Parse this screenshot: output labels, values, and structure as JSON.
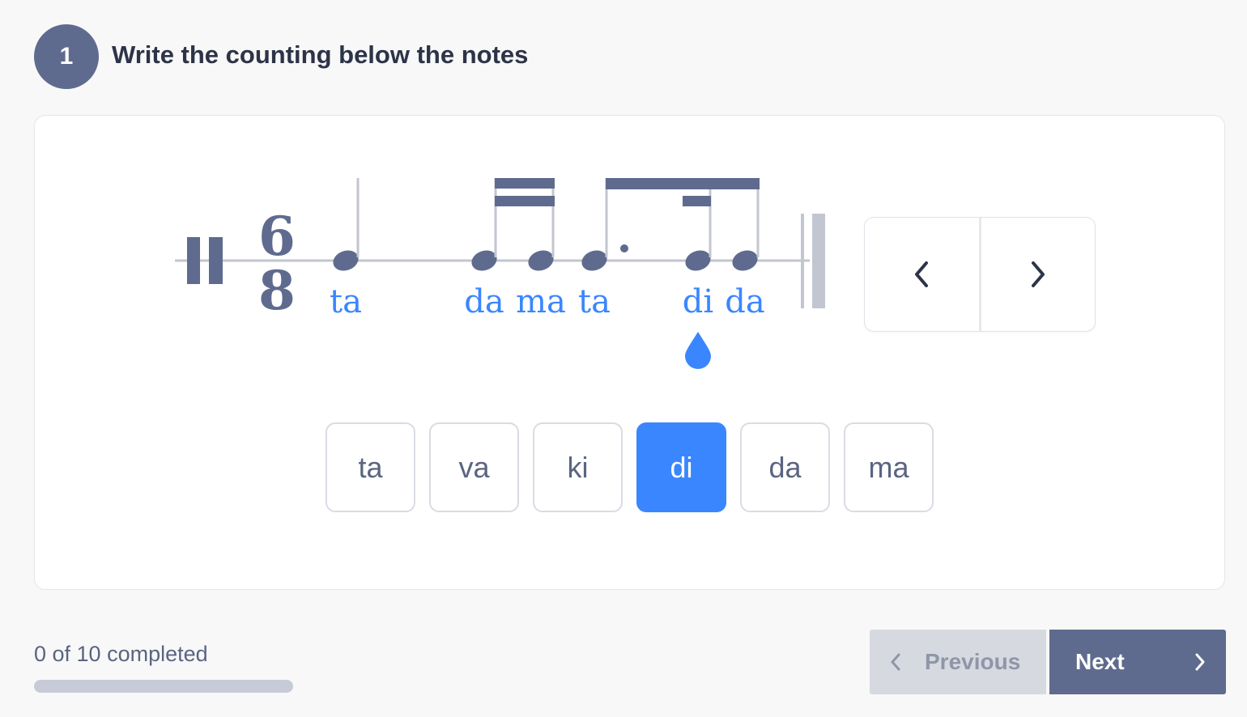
{
  "question": {
    "number": "1",
    "title": "Write the counting below the notes"
  },
  "notation": {
    "time_signature": {
      "top": "6",
      "bottom": "8"
    },
    "syllables": [
      "ta",
      "da",
      "ma",
      "ta",
      "di",
      "da"
    ]
  },
  "nav": {
    "prev_icon": "chevron-left-icon",
    "next_icon": "chevron-right-icon"
  },
  "choices": [
    {
      "label": "ta"
    },
    {
      "label": "va"
    },
    {
      "label": "ki"
    },
    {
      "label": "di",
      "selected": true
    },
    {
      "label": "da"
    },
    {
      "label": "ma"
    }
  ],
  "progress": {
    "text": "0 of 10 completed",
    "completed": 0,
    "total": 10
  },
  "footer": {
    "previous_label": "Previous",
    "next_label": "Next"
  },
  "colors": {
    "accent": "#3a86ff",
    "primary": "#5f6b8e",
    "text": "#2d3448"
  }
}
